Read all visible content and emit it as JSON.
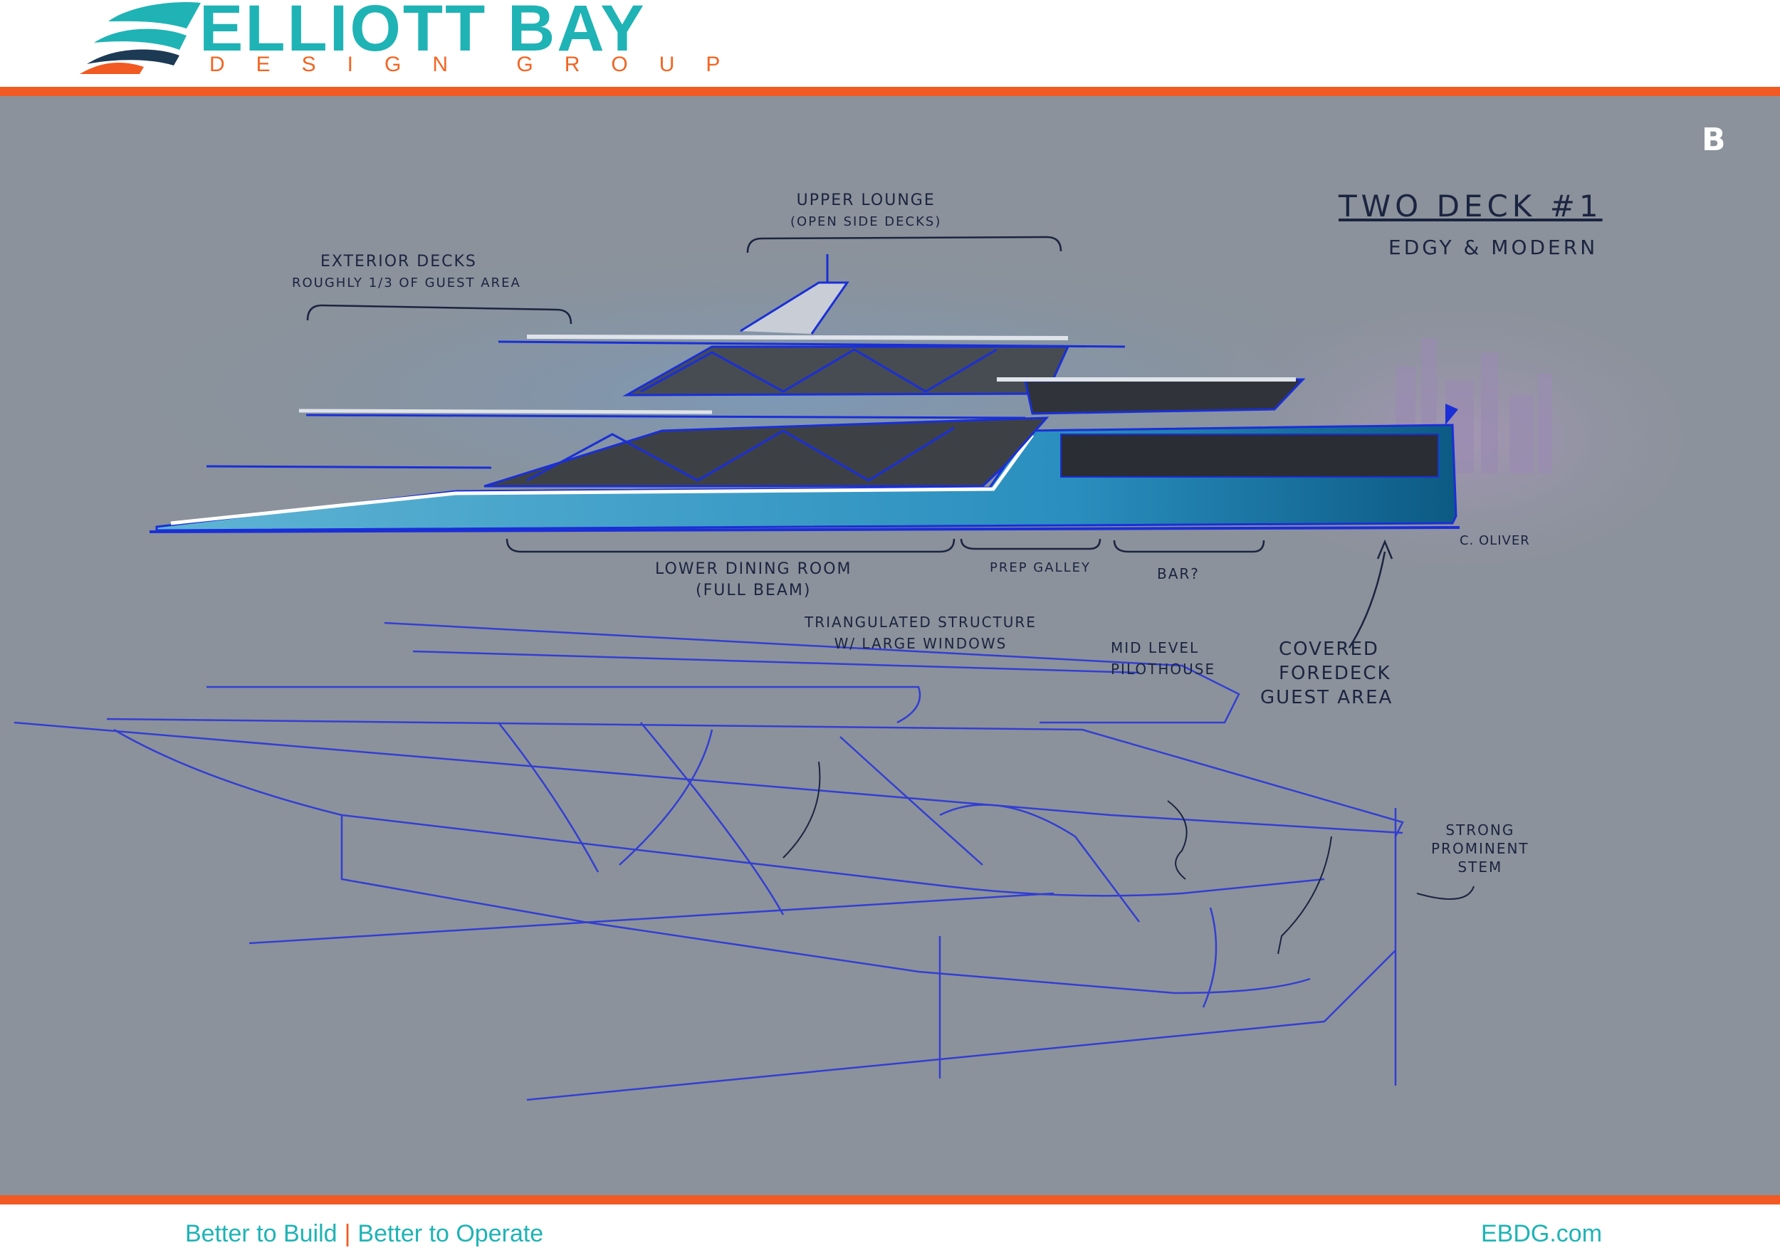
{
  "brand": {
    "name": "ELLIOTT BAY",
    "tagline": "DESIGN GROUP",
    "colors": {
      "teal": "#1fb3b5",
      "orange": "#f15a22",
      "navy": "#1d3a55"
    }
  },
  "sheet": {
    "id_mark": "B",
    "background": "#8b929b",
    "title": "Two Deck #1",
    "subtitle": "Edgy & Modern",
    "signature": "C. Oliver",
    "annotations": {
      "upper_lounge": [
        "Upper Lounge",
        "(Open Side Decks)"
      ],
      "exterior_decks": [
        "Exterior Decks",
        "Roughly 1/3 of Guest Area"
      ],
      "lower_dining": [
        "Lower Dining Room",
        "(Full Beam)"
      ],
      "prep_galley": "Prep Galley",
      "bar": "Bar?",
      "triangulated": [
        "Triangulated Structure",
        "w/ Large Windows"
      ],
      "mid_level": [
        "Mid Level",
        "Pilothouse"
      ],
      "covered_foredeck": [
        "Covered",
        "Foredeck",
        "Guest Area"
      ],
      "strong_stem": [
        "Strong",
        "Prominent",
        "Stem"
      ]
    }
  },
  "footer": {
    "slogan_left": "Better to Build",
    "separator": "|",
    "slogan_right": "Better to Operate",
    "website": "EBDG.com"
  }
}
